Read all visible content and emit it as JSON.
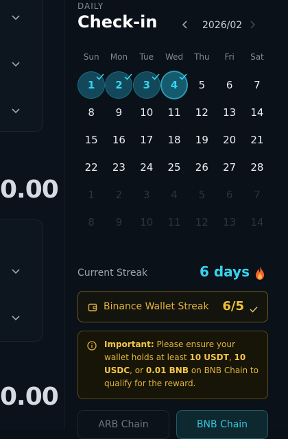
{
  "left": {
    "amounts": [
      "0.00",
      "0.00"
    ]
  },
  "checkin": {
    "eyebrow": "DAILY",
    "title": "Check-in",
    "month": "2026/02",
    "weekdays": [
      "Sun",
      "Mon",
      "Tue",
      "Wed",
      "Thu",
      "Fri",
      "Sat"
    ],
    "days": [
      "1",
      "2",
      "3",
      "4",
      "5",
      "6",
      "7",
      "8",
      "9",
      "10",
      "11",
      "12",
      "13",
      "14",
      "15",
      "16",
      "17",
      "18",
      "19",
      "20",
      "21",
      "22",
      "23",
      "24",
      "25",
      "26",
      "27",
      "28"
    ],
    "next_month_days": [
      "1",
      "2",
      "3",
      "4",
      "5",
      "6",
      "7",
      "8",
      "9",
      "10",
      "11",
      "12",
      "13",
      "14"
    ],
    "checked_days": [
      1,
      2,
      3,
      4
    ],
    "today": 4
  },
  "streak": {
    "label": "Current Streak",
    "value": "6 days"
  },
  "wallet_streak": {
    "label": "Binance Wallet Streak",
    "count": "6/5"
  },
  "notice": {
    "strong": "Important:",
    "text_1": " Please ensure your wallet holds at least ",
    "usdt": "10 USDT",
    "text_2": ", ",
    "usdc": "10 USDC",
    "text_3": ", or ",
    "bnb": "0.01 BNB",
    "text_4": " on BNB Chain to qualify for the reward."
  },
  "tabs": {
    "arb": "ARB Chain",
    "bnb": "BNB Chain"
  },
  "colors": {
    "accent": "#36d3ef",
    "gold": "#e0b23a",
    "background": "#0a1118"
  }
}
